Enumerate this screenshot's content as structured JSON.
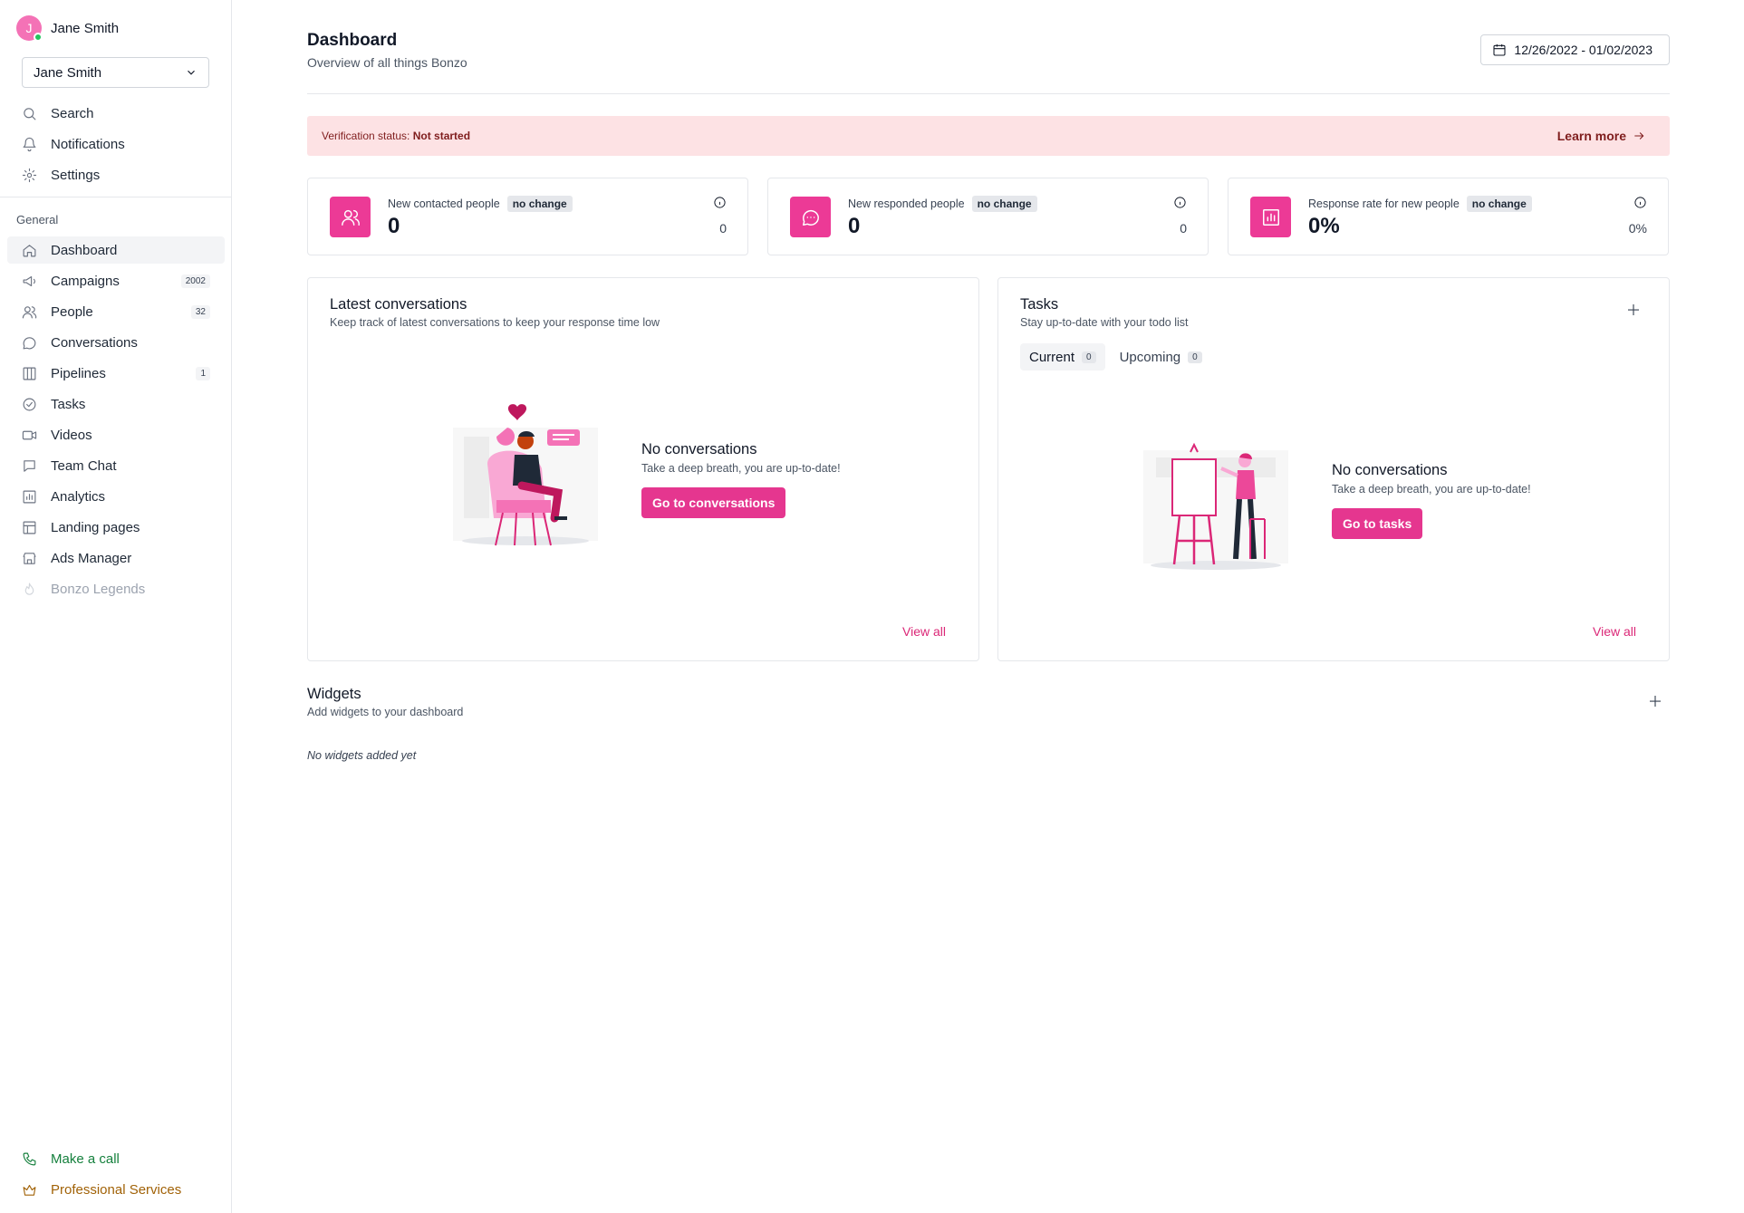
{
  "user": {
    "initial": "J",
    "name": "Jane Smith",
    "selector_value": "Jane Smith"
  },
  "top_nav": [
    {
      "label": "Search",
      "icon": "search-icon"
    },
    {
      "label": "Notifications",
      "icon": "bell-icon"
    },
    {
      "label": "Settings",
      "icon": "gear-icon"
    }
  ],
  "section_label": "General",
  "nav": [
    {
      "label": "Dashboard",
      "icon": "home-icon",
      "active": true
    },
    {
      "label": "Campaigns",
      "icon": "megaphone-icon",
      "badge": "2002"
    },
    {
      "label": "People",
      "icon": "users-icon",
      "badge": "32"
    },
    {
      "label": "Conversations",
      "icon": "chat-icon"
    },
    {
      "label": "Pipelines",
      "icon": "columns-icon",
      "badge": "1"
    },
    {
      "label": "Tasks",
      "icon": "check-circle-icon"
    },
    {
      "label": "Videos",
      "icon": "video-icon"
    },
    {
      "label": "Team Chat",
      "icon": "message-square-icon"
    },
    {
      "label": "Analytics",
      "icon": "bar-chart-icon"
    },
    {
      "label": "Landing pages",
      "icon": "layout-icon"
    },
    {
      "label": "Ads Manager",
      "icon": "store-icon"
    },
    {
      "label": "Bonzo Legends",
      "icon": "flame-icon",
      "disabled": true
    }
  ],
  "bottom_nav": [
    {
      "label": "Make a call",
      "icon": "phone-icon",
      "color": "#15803d"
    },
    {
      "label": "Professional Services",
      "icon": "crown-icon",
      "color": "#a16207"
    }
  ],
  "header": {
    "title": "Dashboard",
    "subtitle": "Overview of all things Bonzo",
    "date_range": "12/26/2022 - 01/02/2023"
  },
  "banner": {
    "prefix": "Verification status: ",
    "status": "Not started",
    "link": "Learn more"
  },
  "stats": [
    {
      "label": "New contacted people",
      "pill": "no change",
      "value": "0",
      "previous": "0",
      "icon": "users-icon"
    },
    {
      "label": "New responded people",
      "pill": "no change",
      "value": "0",
      "previous": "0",
      "icon": "chat-icon"
    },
    {
      "label": "Response rate for new people",
      "pill": "no change",
      "value": "0%",
      "previous": "0%",
      "icon": "chart-icon"
    }
  ],
  "conversations": {
    "title": "Latest conversations",
    "subtitle": "Keep track of latest conversations to keep your response time low",
    "empty_title": "No conversations",
    "empty_text": "Take a deep breath, you are up-to-date!",
    "button": "Go to conversations",
    "view_all": "View all"
  },
  "tasks": {
    "title": "Tasks",
    "subtitle": "Stay up-to-date with your todo list",
    "tabs": [
      {
        "label": "Current",
        "count": "0"
      },
      {
        "label": "Upcoming",
        "count": "0"
      }
    ],
    "empty_title": "No conversations",
    "empty_text": "Take a deep breath, you are up-to-date!",
    "button": "Go to tasks",
    "view_all": "View all"
  },
  "widgets": {
    "title": "Widgets",
    "subtitle": "Add widgets to your dashboard",
    "empty": "No widgets added yet"
  },
  "colors": {
    "brand": "#ec3a96",
    "banner_bg": "#fde2e4",
    "link": "#db2777"
  }
}
